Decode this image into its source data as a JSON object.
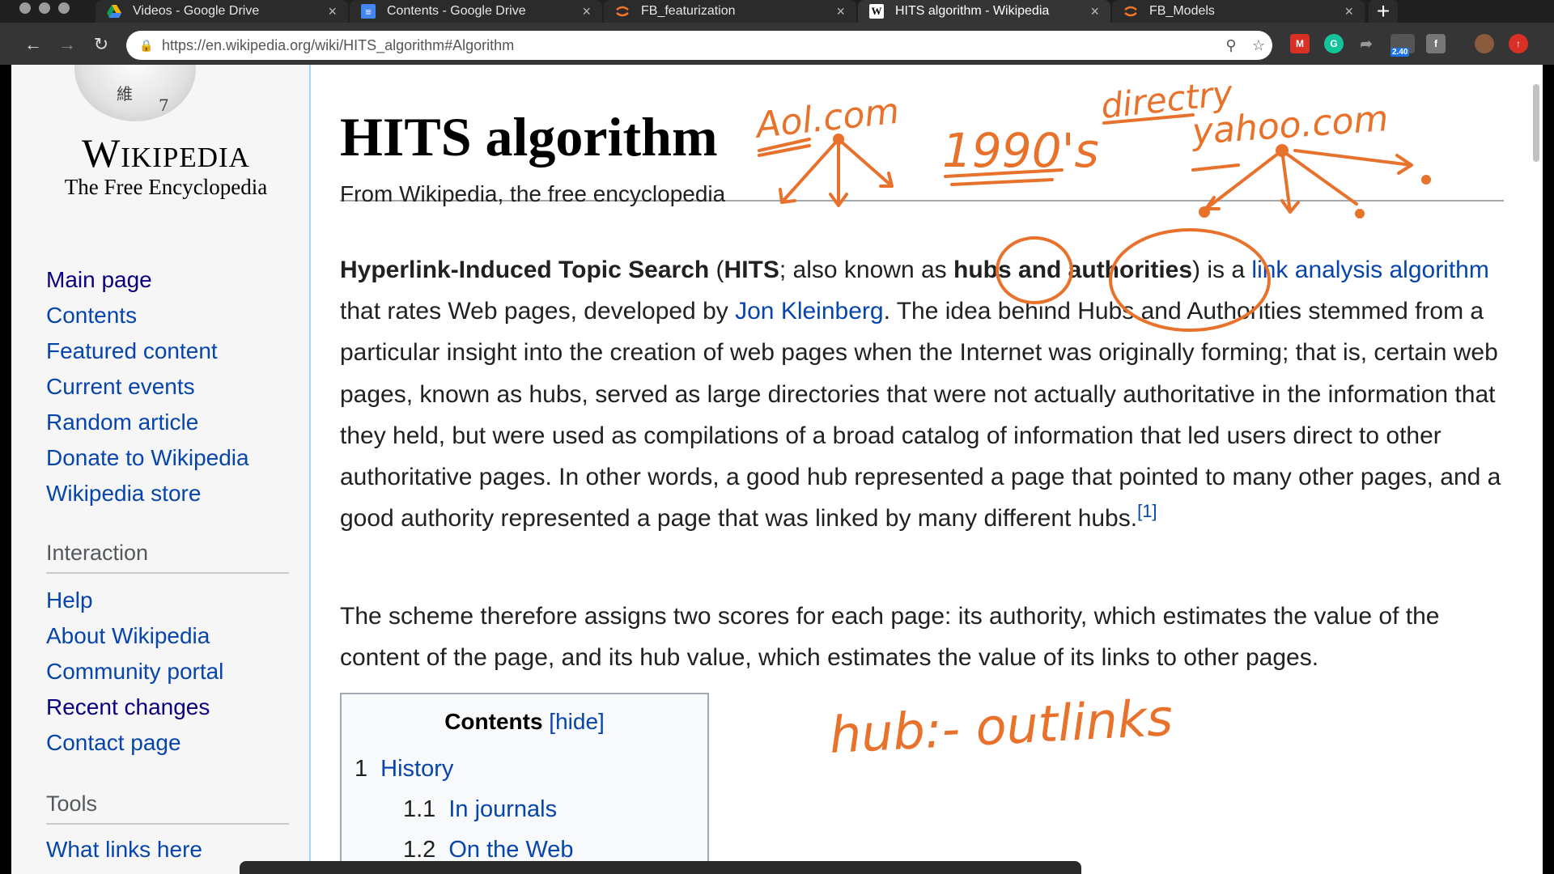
{
  "browser": {
    "tabs": [
      {
        "title": "Videos - Google Drive",
        "icon": "drive-icon"
      },
      {
        "title": "Contents - Google Drive",
        "icon": "docs-icon"
      },
      {
        "title": "FB_featurization",
        "icon": "jupyter-icon"
      },
      {
        "title": "HITS algorithm - Wikipedia",
        "icon": "wikipedia-icon"
      },
      {
        "title": "FB_Models",
        "icon": "jupyter-icon"
      }
    ],
    "active_tab_index": 3,
    "url": "https://en.wikipedia.org/wiki/HITS_algorithm#Algorithm",
    "extension_badge": "2.40"
  },
  "sidebar": {
    "logo_wordmark": "Wikipedia",
    "logo_tagline": "The Free Encyclopedia",
    "navigation": [
      "Main page",
      "Contents",
      "Featured content",
      "Current events",
      "Random article",
      "Donate to Wikipedia",
      "Wikipedia store"
    ],
    "interaction_heading": "Interaction",
    "interaction": [
      "Help",
      "About Wikipedia",
      "Community portal",
      "Recent changes",
      "Contact page"
    ],
    "tools_heading": "Tools",
    "tools": [
      "What links here"
    ]
  },
  "article": {
    "title": "HITS algorithm",
    "from": "From Wikipedia, the free encyclopedia",
    "p1": {
      "t1": "Hyperlink-Induced Topic Search",
      "t2": " (",
      "t3": "HITS",
      "t4": "; also known as ",
      "t5": "hubs and authorities",
      "t6": ") is a ",
      "link1": "link analysis algorithm",
      "t7": " that rates Web pages, developed by ",
      "link2": "Jon Kleinberg",
      "t8": ". The idea behind Hubs and Authorities stemmed from a particular insight into the creation of web pages when the Internet was originally forming; that is, certain web pages, known as hubs, served as large directories that were not actually authoritative in the information that they held, but were used as compilations of a broad catalog of information that led users direct to other authoritative pages. In other words, a good hub represented a page that pointed to many other pages, and a good authority represented a page that was linked by many different hubs.",
      "ref": "[1]"
    },
    "p2": "The scheme therefore assigns two scores for each page: its authority, which estimates the value of the content of the page, and its hub value, which estimates the value of its links to other pages.",
    "toc": {
      "title": "Contents",
      "hide": "[hide]",
      "items": [
        {
          "num": "1",
          "label": "History"
        },
        {
          "num": "1.1",
          "label": "In journals"
        },
        {
          "num": "1.2",
          "label": "On the Web"
        }
      ]
    }
  },
  "annotations": {
    "color": "#e8722b",
    "aol": "Aol.com",
    "era": "1990's",
    "directory": "directry",
    "yahoo": "yahoo.com",
    "hub_note": "hub:- outlinks"
  }
}
